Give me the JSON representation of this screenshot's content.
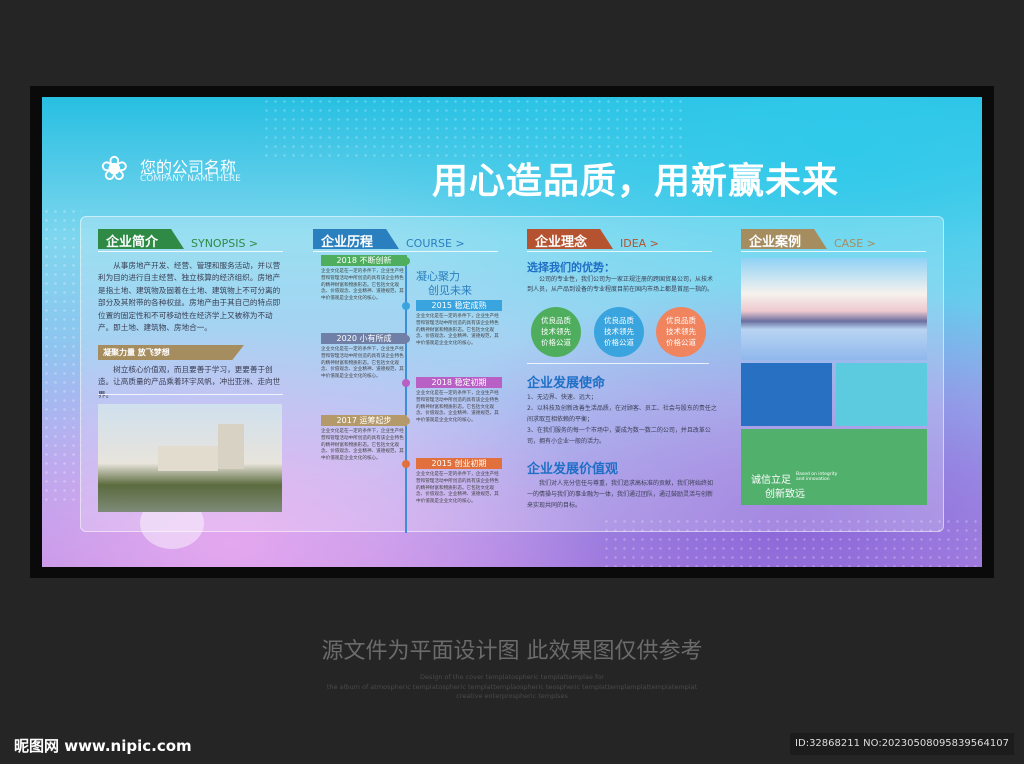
{
  "header": {
    "company_cn": "您的公司名称",
    "company_en": "COMPANY NAME HERE",
    "slogan": "用心造品质，用新赢未来"
  },
  "synopsis": {
    "title": "企业简介",
    "sub": "SYNOPSIS >",
    "body": "　　从事房地产开发、经营、管理和服务活动，并以营利为目的进行自主经营、独立核算的经济组织。房地产是指土地、建筑物及固着在土地、建筑物上不可分离的部分及其附带的各种权益。房地产由于其自己的特点即位置的固定性和不可移动性在经济学上又被称为不动产。即土地、建筑物、房地合一。",
    "banner": "凝聚力量 放飞梦想",
    "body2": "　　树立核心价值观，而且要善于学习，更要善于创造。让高质量的产品乘着环宇风帆，冲出亚洲、走向世界。"
  },
  "course": {
    "title": "企业历程",
    "sub": "COURSE >",
    "motto1": "凝心聚力",
    "motto2": "创见未来",
    "body": "企业文化是在一定的条件下，企业生产经营和管理活动中所创造的具有该企业特色的精神财富和物质形态。它包括文化观念、价值观念、企业精神、道德规范，其中价值观是企业文化的核心。",
    "items": [
      {
        "label": "2018 不断创新",
        "color": "#4fae5e"
      },
      {
        "label": "2015 稳定成熟",
        "color": "#3aa4de"
      },
      {
        "label": "2020 小有所成",
        "color": "#6f7fa6"
      },
      {
        "label": "2018 稳定初期",
        "color": "#b860c4"
      },
      {
        "label": "2017 运筹起步",
        "color": "#b49a6a"
      },
      {
        "label": "2015 创业初期",
        "color": "#e2703c"
      }
    ]
  },
  "idea": {
    "title": "企业理念",
    "sub": "IDEA >",
    "adv_title": "选择我们的优势：",
    "adv_body": "　　公司的专业性，我们公司为一家正规注册的跨国贸易公司，从技术到人员，从产品到设备的专业程度目前在国内市场上都是首屈一指的。",
    "circle": [
      "优良品质",
      "技术领先",
      "价格公道"
    ],
    "mission_title": "企业发展使命",
    "mission": [
      "1、无边界、快速、远大；",
      "2、以科技及创新改善生活品质，在对顾客、员工、社会与股东的责任之间求取互相依赖的平衡；",
      "3、在我们服务的每一个市场中，要成为数一数二的公司，并且改革公司，拥有小企业一般的活力。"
    ],
    "values_title": "企业发展价值观",
    "values": "　　我们对人充分信任与尊重，我们追求高标准的贡献，我们将始终如一的情操与我们的事业融为一体，我们通过团队，通过鼓励灵活与创新来实现共同的目标。"
  },
  "case": {
    "title": "企业案例",
    "sub": "CASE >",
    "motto1": "诚信立足",
    "motto2": "创新致远",
    "motto_en1": "Based on integrity",
    "motto_en2": "and innovation"
  },
  "footer": {
    "notice": "源文件为平面设计图 此效果图仅供参考",
    "desc1": "Design of the cover templatospheric templattemplae for",
    "desc2": "the album of atmospheric templatospheric templattemplaospheric teospheric templattemplamplattemplatemplat",
    "desc3": "creative enterprospheric templses",
    "site_logo": "昵图网 www.nipic.com",
    "id": "ID:32868211 NO:20230508095839564107"
  }
}
